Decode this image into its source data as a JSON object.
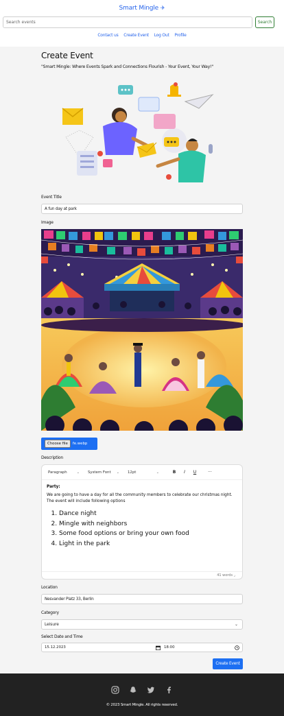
{
  "header": {
    "brand": "Smart Mingle",
    "brand_icon": "paper-plane-icon",
    "search": {
      "placeholder": "Search events",
      "value": ""
    },
    "search_button": "Search",
    "nav": [
      "Contact us",
      "Create Event",
      "Log Out",
      "Profile"
    ]
  },
  "page": {
    "title": "Create Event",
    "tagline": "\"Smart Mingle: Where Events Spark and Connections Flourish - Your Event, Your Way!\""
  },
  "form": {
    "title_label": "Event Title",
    "title_value": "A fun day at park",
    "image_label": "Image",
    "file_button": "Choose file",
    "file_name": "fe.webp",
    "description_label": "Description",
    "editor": {
      "block_format": "Paragraph",
      "font_family": "System Font",
      "font_size": "12pt",
      "bold": "B",
      "italic": "I",
      "underline": "U",
      "more": "···",
      "heading": "Party:",
      "paragraph": "We are going to have a day for all the community members to celebrate our christmas night. The event will include following options",
      "list": [
        "Dance night",
        "Mingle with neighbors",
        "Some food options or bring your own food",
        "Light in the park"
      ],
      "word_count": "41 words"
    },
    "location_label": "Location",
    "location_value": "Nesvander Platz 33, Berlin",
    "category_label": "Category",
    "category_value": "Leisure",
    "datetime_label": "Select Date and Time",
    "date_value": "15.12.2023",
    "time_value": "18:00",
    "submit": "Create Event"
  },
  "footer": {
    "social_icons": [
      "instagram-icon",
      "snapchat-icon",
      "twitter-icon",
      "facebook-icon"
    ],
    "copyright": "© 2023 Smart Mingle. All rights reserved."
  },
  "colors": {
    "accent": "#1d6ff2",
    "link": "#2563eb",
    "search_button": "#2e7d32",
    "footer": "#222222",
    "page_bg": "#f4f4f4"
  }
}
